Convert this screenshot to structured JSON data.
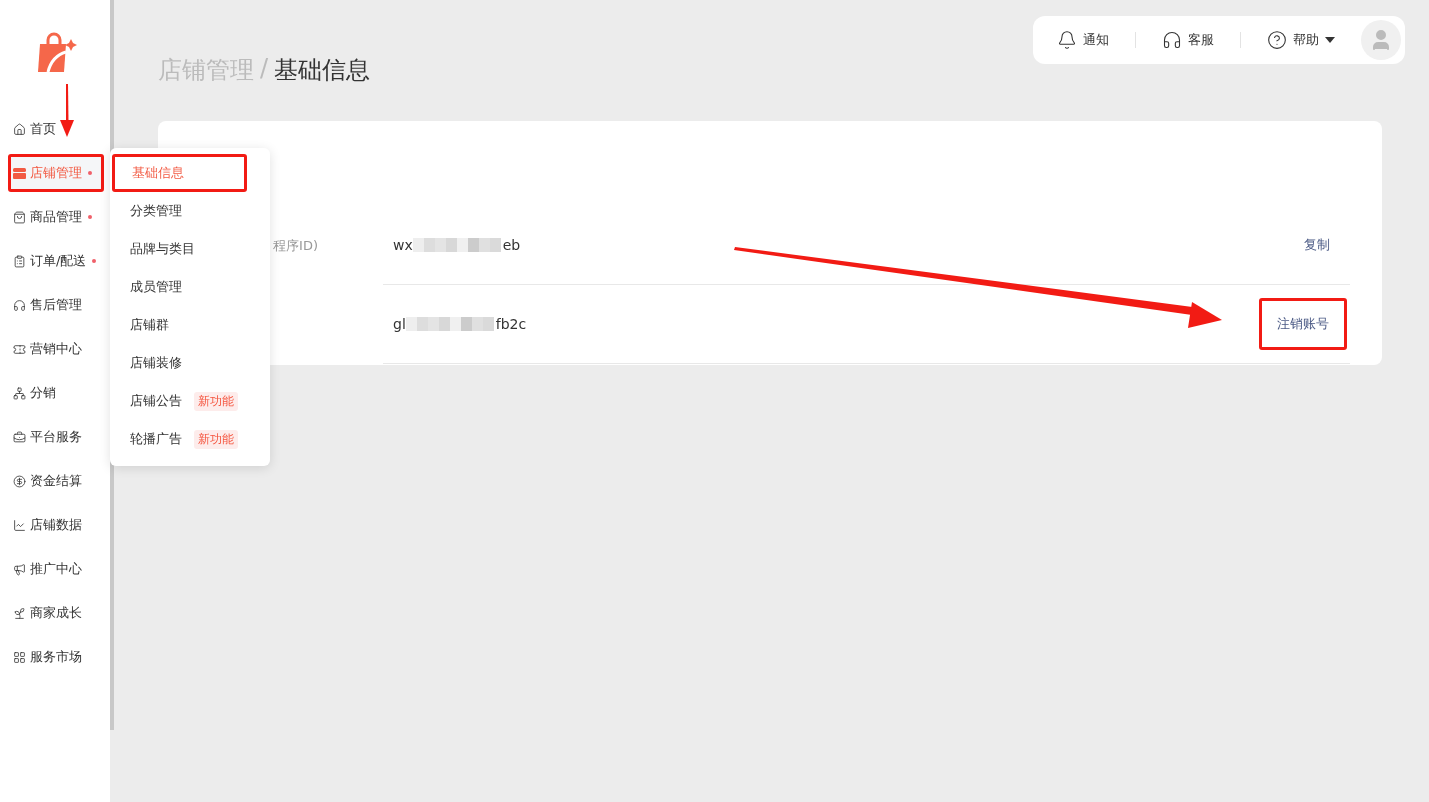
{
  "breadcrumb": [
    {
      "label": "店铺管理",
      "current": false
    },
    {
      "label": "/",
      "current": false
    },
    {
      "label": "基础信息",
      "current": true
    }
  ],
  "topbar": {
    "items": [
      {
        "kind": "bell",
        "label": "通知"
      },
      {
        "kind": "headset",
        "label": "客服"
      },
      {
        "kind": "help",
        "label": "帮助"
      }
    ]
  },
  "sidebar": {
    "items": [
      {
        "kind": "home",
        "label": "首页",
        "selected": false,
        "dot": false,
        "highlighted": false
      },
      {
        "kind": "store",
        "label": "店铺管理",
        "selected": true,
        "dot": true,
        "highlighted": true
      },
      {
        "kind": "bag",
        "label": "商品管理",
        "selected": false,
        "dot": true,
        "highlighted": false
      },
      {
        "kind": "order",
        "label": "订单/配送",
        "selected": false,
        "dot": true,
        "highlighted": false
      },
      {
        "kind": "headset",
        "label": "售后管理",
        "selected": false,
        "dot": false,
        "highlighted": false
      },
      {
        "kind": "ticket",
        "label": "营销中心",
        "selected": false,
        "dot": false,
        "highlighted": false
      },
      {
        "kind": "share",
        "label": "分销",
        "selected": false,
        "dot": false,
        "highlighted": false
      },
      {
        "kind": "briefcase",
        "label": "平台服务",
        "selected": false,
        "dot": false,
        "highlighted": false
      },
      {
        "kind": "yen",
        "label": "资金结算",
        "selected": false,
        "dot": false,
        "highlighted": false
      },
      {
        "kind": "chart",
        "label": "店铺数据",
        "selected": false,
        "dot": false,
        "highlighted": false
      },
      {
        "kind": "megaphone",
        "label": "推广中心",
        "selected": false,
        "dot": false,
        "highlighted": false
      },
      {
        "kind": "sprout",
        "label": "商家成长",
        "selected": false,
        "dot": false,
        "highlighted": false
      },
      {
        "kind": "grid",
        "label": "服务市场",
        "selected": false,
        "dot": false,
        "highlighted": false
      }
    ]
  },
  "submenu": {
    "items": [
      {
        "label": "基础信息",
        "selected": true,
        "highlighted": true
      },
      {
        "label": "分类管理",
        "selected": false,
        "highlighted": false
      },
      {
        "label": "品牌与类目",
        "selected": false,
        "highlighted": false
      },
      {
        "label": "成员管理",
        "selected": false,
        "highlighted": false
      },
      {
        "label": "店铺群",
        "selected": false,
        "highlighted": false
      },
      {
        "label": "店铺装修",
        "selected": false,
        "highlighted": false
      },
      {
        "label": "店铺公告",
        "selected": false,
        "highlighted": false,
        "badge": "新功能"
      },
      {
        "label": "轮播广告",
        "selected": false,
        "highlighted": false,
        "badge": "新功能"
      }
    ]
  },
  "info_rows": [
    {
      "label": "程序ID)",
      "value_start": "wx",
      "value_end": "eb",
      "action": "复制",
      "highlighted": false
    },
    {
      "value_start": "gl",
      "value_end": "fb2c",
      "action": "注销账号",
      "highlighted": true
    }
  ]
}
